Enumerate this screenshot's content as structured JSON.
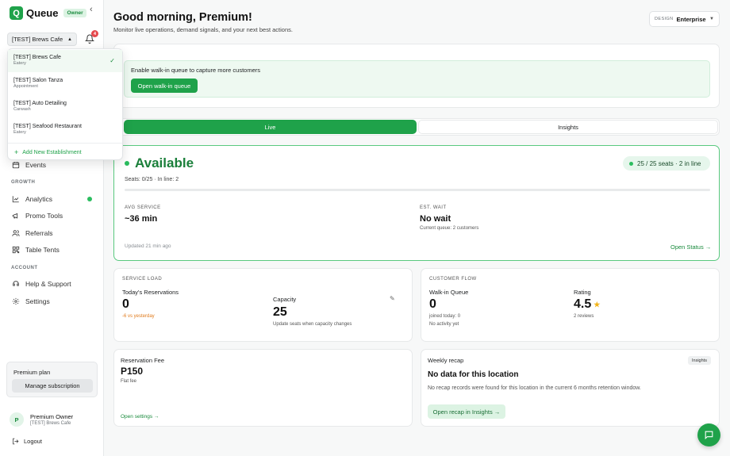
{
  "app": {
    "name": "Queue",
    "role_badge": "Owner"
  },
  "selector": {
    "current": "[TEST] Brews Cafe",
    "notification_count": "4"
  },
  "dropdown": {
    "items": [
      {
        "name": "[TEST] Brews Cafe",
        "type": "Eatery"
      },
      {
        "name": "[TEST] Salon Tanza",
        "type": "Appointment"
      },
      {
        "name": "[TEST] Auto Detailing",
        "type": "Carwash"
      },
      {
        "name": "[TEST] Seafood Restaurant",
        "type": "Eatery"
      }
    ],
    "add_label": "Add New Establishment"
  },
  "nav": {
    "events": "Events",
    "growth_section": "GROWTH",
    "analytics": "Analytics",
    "promo_tools": "Promo Tools",
    "referrals": "Referrals",
    "table_tents": "Table Tents",
    "account_section": "ACCOUNT",
    "help": "Help & Support",
    "settings": "Settings"
  },
  "plan": {
    "title": "Premium plan",
    "button": "Manage subscription"
  },
  "user": {
    "initial": "P",
    "name": "Premium Owner",
    "establishment": "[TEST] Brews Cafe",
    "logout": "Logout"
  },
  "header": {
    "greeting": "Good morning, Premium!",
    "subtitle": "Monitor live operations, demand signals, and your next best actions.",
    "design_label": "DESIGN",
    "design_value": "Enterprise"
  },
  "walkin": {
    "text": "Enable walk-in queue to capture more customers",
    "button": "Open walk-in queue"
  },
  "tabs": {
    "live": "Live",
    "insights": "Insights"
  },
  "status": {
    "title": "Available",
    "pill": "25 / 25 seats · 2 in line",
    "seats_line": "Seats: 0/25 · In line: 2",
    "seats_fill_fraction": 0,
    "avg_service_label": "AVG SERVICE",
    "avg_service_value": "~36 min",
    "est_wait_label": "EST. WAIT",
    "est_wait_value": "No wait",
    "est_wait_sub": "Current queue: 2 customers",
    "updated": "Updated 21 min ago",
    "open_link": "Open Status →"
  },
  "service_load": {
    "section": "SERVICE LOAD",
    "reservations_label": "Today's Reservations",
    "reservations_value": "0",
    "reservations_delta": "-6 vs yesterday",
    "capacity_label": "Capacity",
    "capacity_value": "25",
    "capacity_sub": "Update seats when capacity changes"
  },
  "customer_flow": {
    "section": "CUSTOMER FLOW",
    "walkin_label": "Walk-in Queue",
    "walkin_value": "0",
    "walkin_sub1": "joined today: 0",
    "walkin_sub2": "No activity yet",
    "rating_label": "Rating",
    "rating_value": "4.5",
    "rating_sub": "2 reviews"
  },
  "fee": {
    "label": "Reservation Fee",
    "value": "P150",
    "sub": "Flat fee",
    "link": "Open settings →"
  },
  "recap": {
    "title": "Weekly recap",
    "badge": "Insights",
    "heading": "No data for this location",
    "body": "No recap records were found for this location in the current 6 months retention window.",
    "button": "Open recap in Insights →"
  },
  "colors": {
    "accent": "#1fa24a",
    "accent_light": "#dcf3e3",
    "warning": "#e07a1b",
    "star": "#f2b318"
  }
}
